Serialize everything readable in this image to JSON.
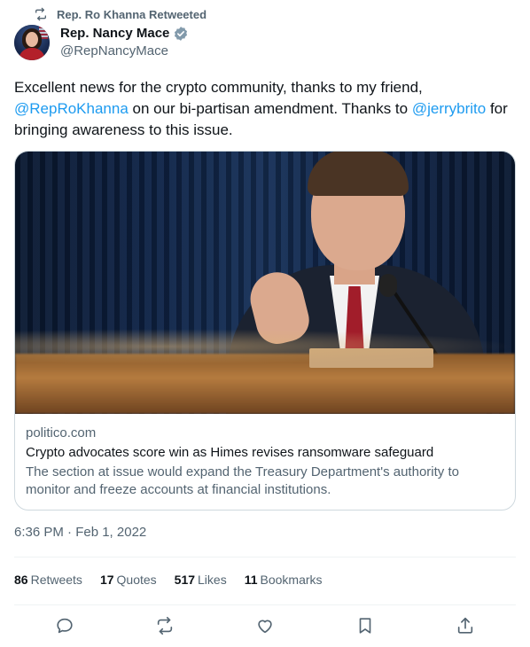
{
  "retweet": {
    "label": "Rep. Ro Khanna Retweeted"
  },
  "author": {
    "name": "Rep. Nancy Mace",
    "handle": "@RepNancyMace"
  },
  "tweet": {
    "text_part1": "Excellent news for the crypto community, thanks to my friend, ",
    "mention1": "@RepRoKhanna",
    "text_part2": " on our bi-partisan amendment. Thanks to ",
    "mention2": "@jerrybrito",
    "text_part3": " for bringing awareness to this issue."
  },
  "card": {
    "domain": "politico.com",
    "title": "Crypto advocates score win as Himes revises ransomware safeguard",
    "description": "The section at issue would expand the Treasury Department's authority to monitor and freeze accounts at financial institutions."
  },
  "timestamp": "6:36 PM · Feb 1, 2022",
  "stats": {
    "retweets_count": "86",
    "retweets_label": "Retweets",
    "quotes_count": "17",
    "quotes_label": "Quotes",
    "likes_count": "517",
    "likes_label": "Likes",
    "bookmarks_count": "11",
    "bookmarks_label": "Bookmarks"
  },
  "icons": {
    "retweet": "retweet-icon",
    "verified": "verified-badge-icon",
    "reply": "reply-icon",
    "like": "heart-icon",
    "bookmark": "bookmark-icon",
    "share": "share-icon"
  },
  "colors": {
    "accent": "#1d9bf0",
    "muted": "#536471",
    "text": "#0f1419",
    "border": "#cfd9de"
  }
}
